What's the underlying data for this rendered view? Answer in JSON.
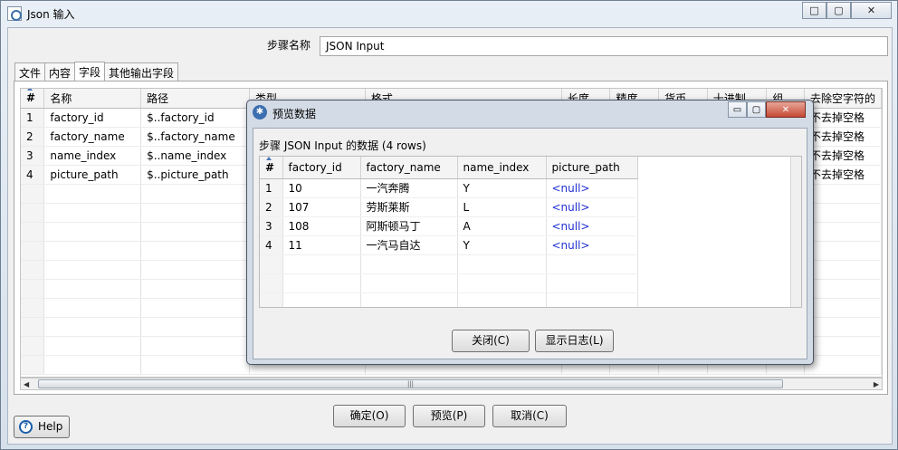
{
  "window": {
    "title": "Json 输入",
    "controls": [
      "□",
      "▢",
      "✕"
    ]
  },
  "step": {
    "label": "步骤名称",
    "value": "JSON Input"
  },
  "tabs": [
    "文件",
    "内容",
    "字段",
    "其他输出字段"
  ],
  "fields_table": {
    "headers": [
      "#",
      "名称",
      "路径",
      "类型",
      "格式",
      "长度",
      "精度",
      "货币",
      "十进制",
      "组",
      "去除空字符的"
    ],
    "rows": [
      [
        "1",
        "factory_id",
        "$..factory_id",
        "",
        "",
        "",
        "",
        "",
        "",
        "",
        "不去掉空格"
      ],
      [
        "2",
        "factory_name",
        "$..factory_name",
        "",
        "",
        "",
        "",
        "",
        "",
        "",
        "不去掉空格"
      ],
      [
        "3",
        "name_index",
        "$..name_index",
        "",
        "",
        "",
        "",
        "",
        "",
        "",
        "不去掉空格"
      ],
      [
        "4",
        "picture_path",
        "$..picture_path",
        "",
        "",
        "",
        "",
        "",
        "",
        "",
        "不去掉空格"
      ]
    ]
  },
  "buttons": {
    "ok": "确定(O)",
    "preview": "预览(P)",
    "cancel": "取消(C)",
    "help": "Help"
  },
  "preview_dialog": {
    "title": "预览数据",
    "caption": "步骤 JSON Input 的数据  (4 rows)",
    "headers": [
      "#",
      "factory_id",
      "factory_name",
      "name_index",
      "picture_path"
    ],
    "rows": [
      [
        "1",
        "10",
        "一汽奔腾",
        "Y",
        "<null>"
      ],
      [
        "2",
        "107",
        "劳斯莱斯",
        "L",
        "<null>"
      ],
      [
        "3",
        "108",
        "阿斯顿马丁",
        "A",
        "<null>"
      ],
      [
        "4",
        "11",
        "一汽马自达",
        "Y",
        "<null>"
      ]
    ],
    "close_button": "关闭(C)",
    "log_button": "显示日志(L)",
    "controls": [
      "▭",
      "▢",
      "✕"
    ]
  },
  "scroll_grip": "|||"
}
